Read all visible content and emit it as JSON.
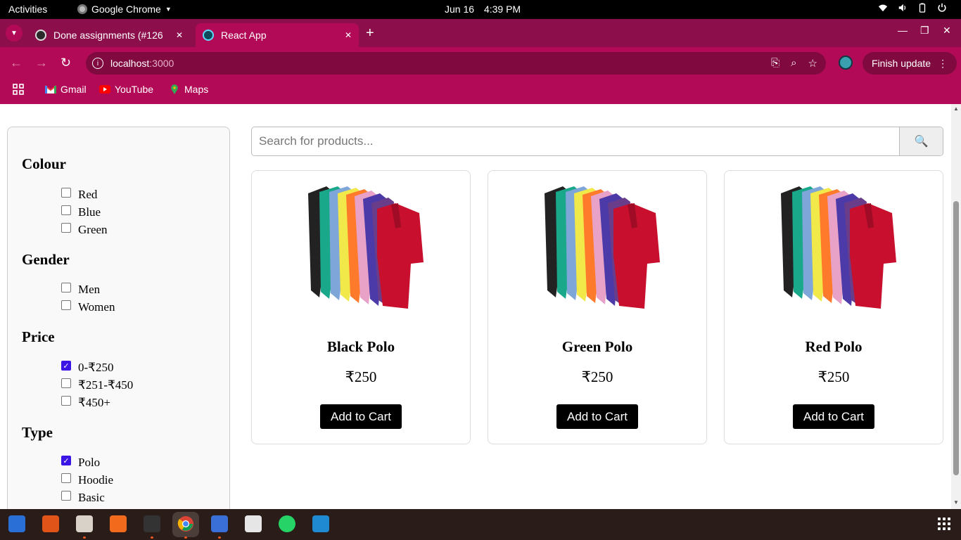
{
  "system_bar": {
    "activities": "Activities",
    "app_name": "Google Chrome",
    "date": "Jun 16",
    "time": "4:39 PM"
  },
  "browser": {
    "tabs": [
      {
        "title": "Done assignments (#126"
      },
      {
        "title": "React App"
      }
    ],
    "url_host": "localhost",
    "url_port": ":3000",
    "finish_update_label": "Finish update",
    "bookmarks": [
      {
        "label": "Gmail",
        "icon": "gmail-icon"
      },
      {
        "label": "YouTube",
        "icon": "youtube-icon"
      },
      {
        "label": "Maps",
        "icon": "maps-icon"
      }
    ],
    "theme_color": "#b30a57"
  },
  "filters": {
    "groups": [
      {
        "title": "Colour",
        "options": [
          {
            "label": "Red",
            "checked": false
          },
          {
            "label": "Blue",
            "checked": false
          },
          {
            "label": "Green",
            "checked": false
          }
        ]
      },
      {
        "title": "Gender",
        "options": [
          {
            "label": "Men",
            "checked": false
          },
          {
            "label": "Women",
            "checked": false
          }
        ]
      },
      {
        "title": "Price",
        "options": [
          {
            "label": "0-₹250",
            "checked": true
          },
          {
            "label": "₹251-₹450",
            "checked": false
          },
          {
            "label": "₹450+",
            "checked": false
          }
        ]
      },
      {
        "title": "Type",
        "options": [
          {
            "label": "Polo",
            "checked": true
          },
          {
            "label": "Hoodie",
            "checked": false
          },
          {
            "label": "Basic",
            "checked": false
          }
        ]
      }
    ]
  },
  "search": {
    "placeholder": "Search for products...",
    "button_icon": "🔍"
  },
  "products": [
    {
      "name": "Black Polo",
      "price": "₹250",
      "button": "Add to Cart"
    },
    {
      "name": "Green Polo",
      "price": "₹250",
      "button": "Add to Cart"
    },
    {
      "name": "Red Polo",
      "price": "₹250",
      "button": "Add to Cart"
    }
  ]
}
